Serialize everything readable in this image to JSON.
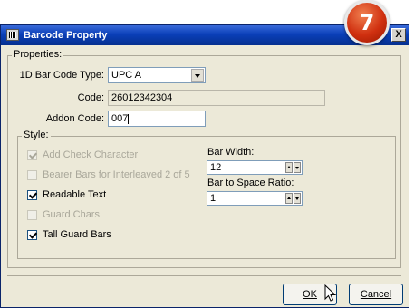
{
  "window": {
    "title": "Barcode Property",
    "close_label": "X",
    "accent_color": "#0a3fb8"
  },
  "step_badge": "7",
  "properties": {
    "legend": "Properties:",
    "bar_code_type_label": "1D Bar Code Type:",
    "bar_code_type_value": "UPC A",
    "code_label": "Code:",
    "code_value": "26012342304",
    "addon_code_label": "Addon Code:",
    "addon_code_value": "007"
  },
  "style": {
    "legend": "Style:",
    "checkboxes": [
      {
        "label": "Add Check Character",
        "checked": true,
        "enabled": false
      },
      {
        "label": "Bearer Bars for Interleaved 2 of 5",
        "checked": false,
        "enabled": false
      },
      {
        "label": "Readable Text",
        "checked": true,
        "enabled": true
      },
      {
        "label": "Guard Chars",
        "checked": false,
        "enabled": false
      },
      {
        "label": "Tall Guard Bars",
        "checked": true,
        "enabled": true
      }
    ],
    "bar_width_label": "Bar Width:",
    "bar_width_value": "12",
    "bar_ratio_label": "Bar to Space Ratio:",
    "bar_ratio_value": "1"
  },
  "buttons": {
    "ok": "OK",
    "cancel": "Cancel"
  }
}
